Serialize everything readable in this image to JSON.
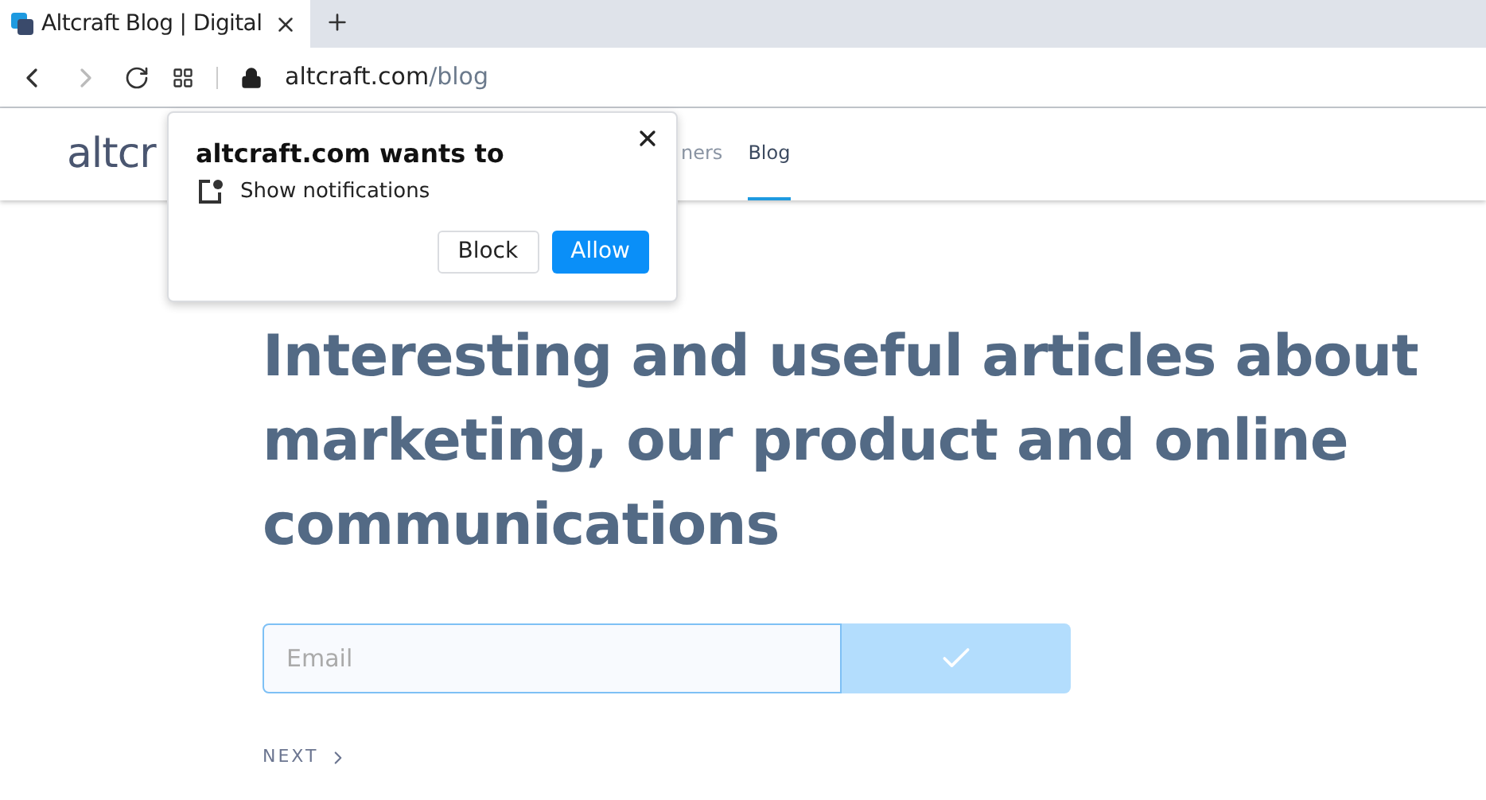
{
  "tab": {
    "title": "Altcraft Blog | Digital",
    "selected": true
  },
  "address_bar": {
    "host": "altcraft.com",
    "path": "/blog"
  },
  "header": {
    "logo": "altcr",
    "nav": [
      {
        "label": "ners",
        "selected": false
      },
      {
        "label": "Blog",
        "selected": true
      }
    ]
  },
  "permission_popup": {
    "title": "altcraft.com wants to",
    "request": "Show notifications",
    "buttons": [
      {
        "label": "Block",
        "kind": "secondary"
      },
      {
        "label": "Allow",
        "kind": "primary"
      }
    ]
  },
  "heading": "Interesting and useful articles about marketing, our product and online communications",
  "subscribe": {
    "placeholder": "Email"
  },
  "next_link": "NEXT"
}
